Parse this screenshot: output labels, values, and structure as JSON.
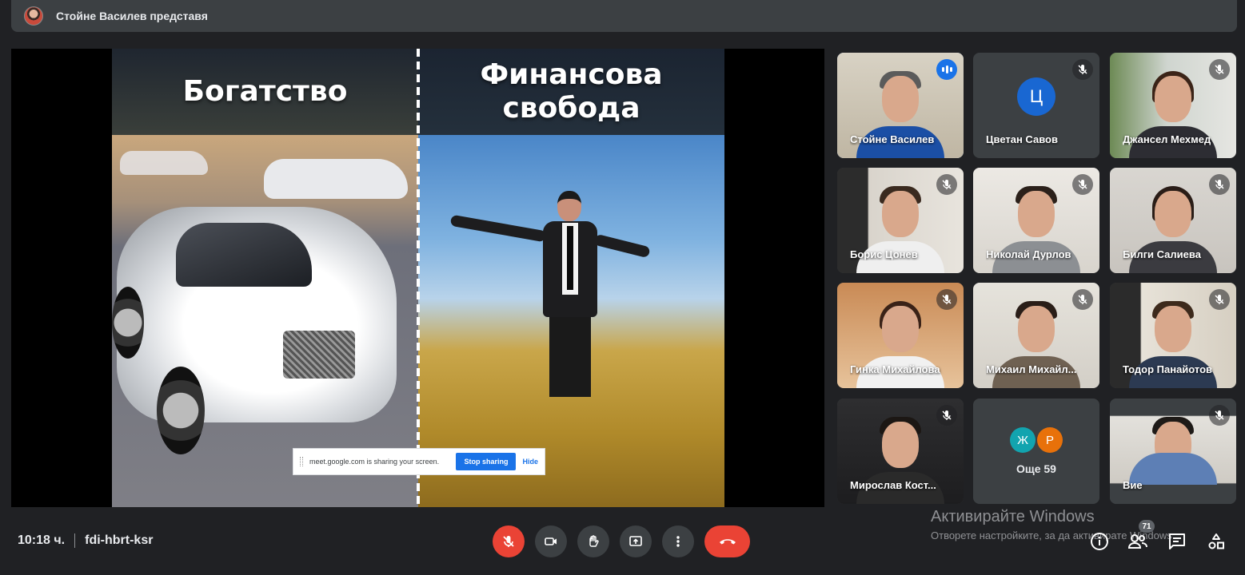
{
  "header": {
    "presenting_text": "Стойне Василев представя"
  },
  "slide": {
    "left_title": "Богатство",
    "right_title_line1": "Финансова",
    "right_title_line2": "свобода"
  },
  "share_bar": {
    "message": "meet.google.com is sharing your screen.",
    "stop_label": "Stop sharing",
    "hide_label": "Hide"
  },
  "participants": [
    {
      "name": "Стойне Василев",
      "state": "speaking"
    },
    {
      "name": "Цветан Савов",
      "initial": "Ц",
      "state": "muted"
    },
    {
      "name": "Джансел Мехмед",
      "state": "muted"
    },
    {
      "name": "Борис Цонев",
      "state": "muted"
    },
    {
      "name": "Николай Дурлов",
      "state": "muted"
    },
    {
      "name": "Билги Салиева",
      "state": "muted"
    },
    {
      "name": "Гинка Михайлова",
      "state": "muted"
    },
    {
      "name": "Михаил Михайл...",
      "state": "muted"
    },
    {
      "name": "Тодор Панайотов",
      "state": "muted"
    },
    {
      "name": "Мирослав Кост...",
      "state": "muted"
    },
    {
      "name": "Вие",
      "state": "muted"
    }
  ],
  "more_tile": {
    "avatars": [
      {
        "letter": "Ж",
        "color": "#12a4af"
      },
      {
        "letter": "Р",
        "color": "#e8710a"
      }
    ],
    "label": "Още 59"
  },
  "footer": {
    "time": "10:18 ч.",
    "meeting_code": "fdi-hbrt-ksr",
    "people_count": "71"
  },
  "watermark": {
    "line1": "Активирайте Windows",
    "line2": "Отворете настройките, за да активирате Windows."
  },
  "colors": {
    "accent": "#8ab4f8",
    "danger": "#ea4335",
    "speaking": "#1a73e8"
  }
}
